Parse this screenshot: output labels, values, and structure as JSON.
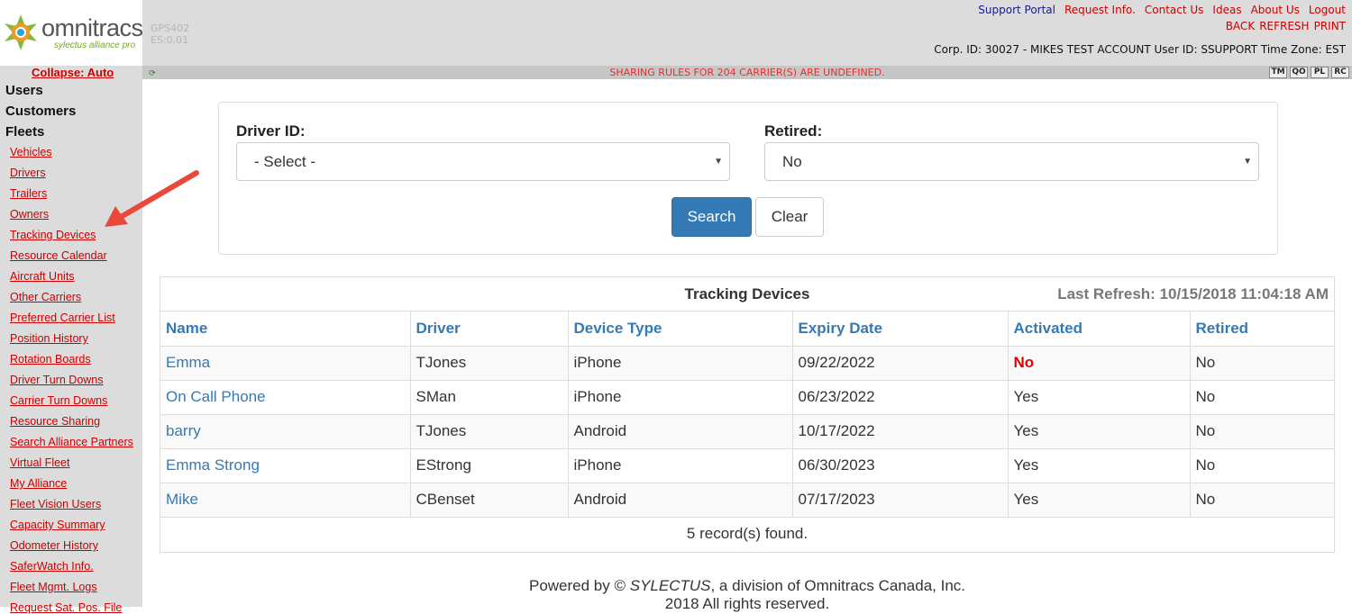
{
  "header": {
    "logo_brand": "omnitracs",
    "logo_tagline": "sylectus alliance pro",
    "version_line1": "GPS402",
    "version_line2": "ES:0.01",
    "links_top": [
      "Support Portal",
      "Request Info.",
      "Contact Us",
      "Ideas",
      "About Us",
      "Logout"
    ],
    "links_second": [
      "BACK",
      "REFRESH",
      "PRINT"
    ],
    "corp_info": "Corp. ID: 30027 - MIKES TEST ACCOUNT User ID: SSUPPORT Time Zone: EST"
  },
  "statusbar": {
    "message": "SHARING RULES FOR 204 CARRIER(S) ARE UNDEFINED.",
    "mini_buttons": [
      "TM",
      "QO",
      "PL",
      "RC"
    ]
  },
  "sidebar": {
    "collapse_label": "Collapse: Auto",
    "sections": [
      "Users",
      "Customers",
      "Fleets"
    ],
    "links": [
      "Vehicles",
      "Drivers",
      "Trailers",
      "Owners",
      "Tracking Devices",
      "Resource Calendar",
      "Aircraft Units",
      "Other Carriers",
      "Preferred Carrier List",
      "Position History",
      "Rotation Boards",
      "Driver Turn Downs",
      "Carrier Turn Downs",
      "Resource Sharing",
      "Search Alliance Partners",
      "Virtual Fleet",
      "My Alliance",
      "Fleet Vision Users",
      "Capacity Summary",
      "Odometer History",
      "SaferWatch Info.",
      "Fleet Mgmt. Logs",
      "Request Sat. Pos. File"
    ]
  },
  "search": {
    "driver_label": "Driver ID:",
    "driver_value": "- Select -",
    "retired_label": "Retired:",
    "retired_value": "No",
    "search_button": "Search",
    "clear_button": "Clear"
  },
  "table": {
    "title": "Tracking Devices",
    "last_refresh": "Last Refresh: 10/15/2018 11:04:18 AM",
    "columns": [
      "Name",
      "Driver",
      "Device Type",
      "Expiry Date",
      "Activated",
      "Retired"
    ],
    "rows": [
      [
        "Emma",
        "TJones",
        "iPhone",
        "09/22/2022",
        "No",
        "No"
      ],
      [
        "On Call Phone",
        "SMan",
        "iPhone",
        "06/23/2022",
        "Yes",
        "No"
      ],
      [
        "barry",
        "TJones",
        "Android",
        "10/17/2022",
        "Yes",
        "No"
      ],
      [
        "Emma Strong",
        "EStrong",
        "iPhone",
        "06/30/2023",
        "Yes",
        "No"
      ],
      [
        "Mike",
        "CBenset",
        "Android",
        "07/17/2023",
        "Yes",
        "No"
      ]
    ],
    "footer": "5 record(s) found."
  },
  "footer": {
    "line1_prefix": "Powered by © ",
    "line1_brand": "SYLECTUS",
    "line1_suffix": ", a division of Omnitracs Canada, Inc.",
    "line2": "2018 All rights reserved."
  },
  "colors": {
    "link_red": "#cc0000",
    "primary_blue": "#337ab7",
    "annotation_arrow": "#e8493c"
  }
}
